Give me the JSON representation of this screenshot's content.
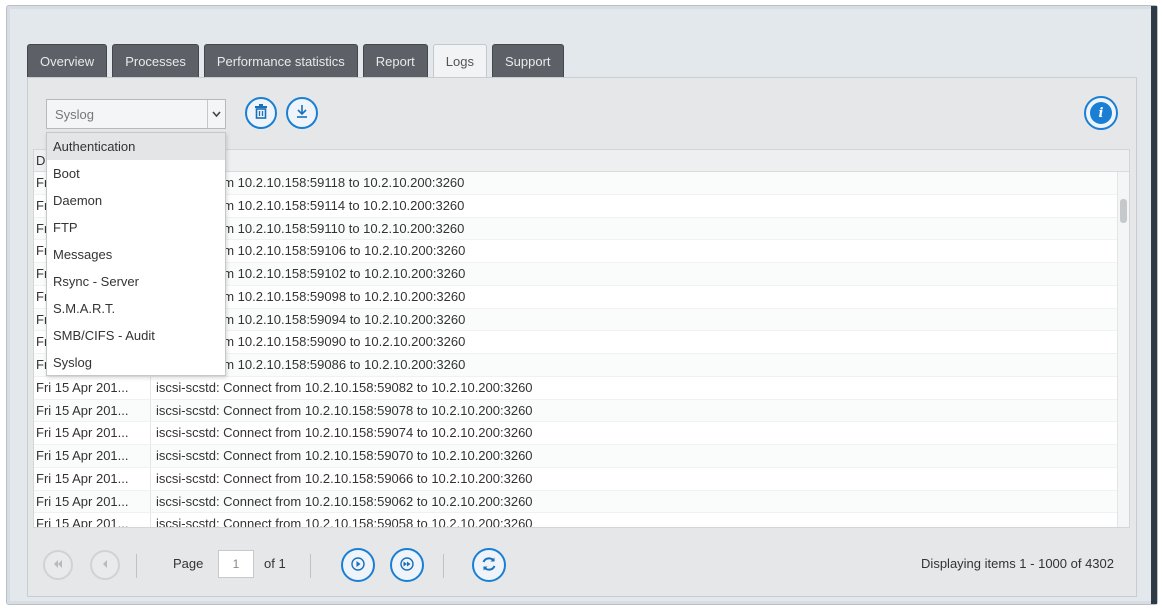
{
  "tabs": [
    {
      "label": "Overview",
      "active": false
    },
    {
      "label": "Processes",
      "active": false
    },
    {
      "label": "Performance statistics",
      "active": false
    },
    {
      "label": "Report",
      "active": false
    },
    {
      "label": "Logs",
      "active": true
    },
    {
      "label": "Support",
      "active": false
    }
  ],
  "toolbar": {
    "log_select_value": "Syslog",
    "clear_icon": "trash-icon",
    "download_icon": "download-icon",
    "info_icon": "info-icon"
  },
  "dropdown": {
    "options": [
      "Authentication",
      "Boot",
      "Daemon",
      "FTP",
      "Messages",
      "Rsync - Server",
      "S.M.A.R.T.",
      "SMB/CIFS - Audit",
      "Syslog"
    ],
    "hovered": "Authentication"
  },
  "grid": {
    "header_date": "D",
    "rows": [
      {
        "date": "Fr",
        "message": "Connect from 10.2.10.158:59118 to 10.2.10.200:3260"
      },
      {
        "date": "Fr",
        "message": "Connect from 10.2.10.158:59114 to 10.2.10.200:3260"
      },
      {
        "date": "Fr",
        "message": "Connect from 10.2.10.158:59110 to 10.2.10.200:3260"
      },
      {
        "date": "Fr",
        "message": "Connect from 10.2.10.158:59106 to 10.2.10.200:3260"
      },
      {
        "date": "Fr",
        "message": "Connect from 10.2.10.158:59102 to 10.2.10.200:3260"
      },
      {
        "date": "Fr",
        "message": "Connect from 10.2.10.158:59098 to 10.2.10.200:3260"
      },
      {
        "date": "Fr",
        "message": "Connect from 10.2.10.158:59094 to 10.2.10.200:3260"
      },
      {
        "date": "Fr",
        "message": "Connect from 10.2.10.158:59090 to 10.2.10.200:3260"
      },
      {
        "date": "Fr",
        "message": "Connect from 10.2.10.158:59086 to 10.2.10.200:3260"
      },
      {
        "date": "Fri 15 Apr 201...",
        "message": "iscsi-scstd: Connect from 10.2.10.158:59082 to 10.2.10.200:3260"
      },
      {
        "date": "Fri 15 Apr 201...",
        "message": "iscsi-scstd: Connect from 10.2.10.158:59078 to 10.2.10.200:3260"
      },
      {
        "date": "Fri 15 Apr 201...",
        "message": "iscsi-scstd: Connect from 10.2.10.158:59074 to 10.2.10.200:3260"
      },
      {
        "date": "Fri 15 Apr 201...",
        "message": "iscsi-scstd: Connect from 10.2.10.158:59070 to 10.2.10.200:3260"
      },
      {
        "date": "Fri 15 Apr 201...",
        "message": "iscsi-scstd: Connect from 10.2.10.158:59066 to 10.2.10.200:3260"
      },
      {
        "date": "Fri 15 Apr 201...",
        "message": "iscsi-scstd: Connect from 10.2.10.158:59062 to 10.2.10.200:3260"
      },
      {
        "date": "Fri 15 Apr 201...",
        "message": "iscsi-scstd: Connect from 10.2.10.158:59058 to 10.2.10.200:3260"
      }
    ]
  },
  "pager": {
    "page_label": "Page",
    "page_value": "1",
    "of_label": "of 1",
    "display_info": "Displaying items 1 - 1000 of 4302",
    "first_icon": "first-page-icon",
    "prev_icon": "prev-page-icon",
    "next_icon": "next-page-icon",
    "last_icon": "last-page-icon",
    "refresh_icon": "refresh-icon"
  }
}
